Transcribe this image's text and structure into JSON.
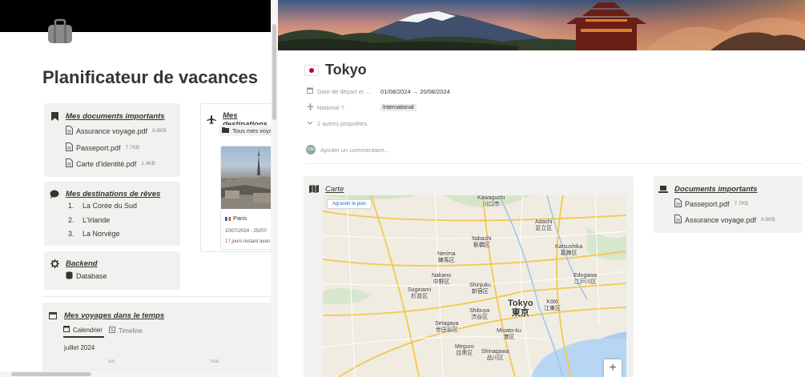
{
  "left": {
    "title": "Planificateur de vacances",
    "documents": {
      "heading": "Mes documents importants",
      "files": [
        {
          "name": "Assurance voyage.pdf",
          "size": "8.8KB"
        },
        {
          "name": "Passeport.pdf",
          "size": "7.7KB"
        },
        {
          "name": "Carte d'identité.pdf",
          "size": "1.4KB"
        }
      ]
    },
    "destinations": {
      "heading": "Mes destinations",
      "tab": "Tous mes voya",
      "item": {
        "name": "Paris",
        "dates": "10/07/2024 - 25/07/",
        "remaining_count": "17",
        "remaining_text": " jours restant avan"
      }
    },
    "dreams": {
      "heading": "Mes destinations de rêves",
      "items": [
        "La Corée du Sud",
        "L'Irlande",
        "La Norvège"
      ]
    },
    "backend": {
      "heading": "Backend",
      "item": "Database"
    },
    "voyages": {
      "heading": "Mes voyages dans le temps",
      "tabs": [
        "Calendrier",
        "Timeline"
      ],
      "month": "juillet 2024",
      "days": [
        "lun.",
        "mar."
      ]
    }
  },
  "right": {
    "title": "Tokyo",
    "properties": [
      {
        "label": "Date de départ et ...",
        "value": "01/08/2024 → 20/08/2024",
        "icon": "calendar-icon"
      },
      {
        "label": "National ?",
        "value": "International",
        "icon": "plane-icon"
      }
    ],
    "more_props": "2 autres propriétés",
    "comment_placeholder": "Ajouter un commentaire...",
    "map": {
      "heading": "Carte",
      "enlarge": "Agrandir le plan",
      "zoom_in": "+",
      "labels": [
        {
          "t": "Kawaguchi",
          "j": "川口市"
        },
        {
          "t": "Adachi",
          "j": "足立区"
        },
        {
          "t": "Itabashi",
          "j": "板橋区"
        },
        {
          "t": "Katsushika",
          "j": "葛飾区"
        },
        {
          "t": "Nerima",
          "j": "練馬区"
        },
        {
          "t": "Nakano",
          "j": "中野区"
        },
        {
          "t": "Shinjuku",
          "j": "新宿区"
        },
        {
          "t": "Edogawa",
          "j": "江戸川区"
        },
        {
          "t": "Suginami",
          "j": "杉並区"
        },
        {
          "t": "Shibuya",
          "j": "渋谷区"
        },
        {
          "t": "Tokyo",
          "j": "東京"
        },
        {
          "t": "Kōtō",
          "j": "江東区"
        },
        {
          "t": "Setagaya",
          "j": "世田谷区"
        },
        {
          "t": "Minato-ku",
          "j": "港区"
        },
        {
          "t": "Meguro",
          "j": "目黒区"
        },
        {
          "t": "Shinagawa",
          "j": "品川区"
        }
      ]
    },
    "docs": {
      "heading": "Documents importants",
      "files": [
        {
          "name": "Passeport.pdf",
          "size": "7.7KB"
        },
        {
          "name": "Assurance voyage.pdf",
          "size": "8.8KB"
        }
      ]
    }
  },
  "avatar_initials": "DM"
}
